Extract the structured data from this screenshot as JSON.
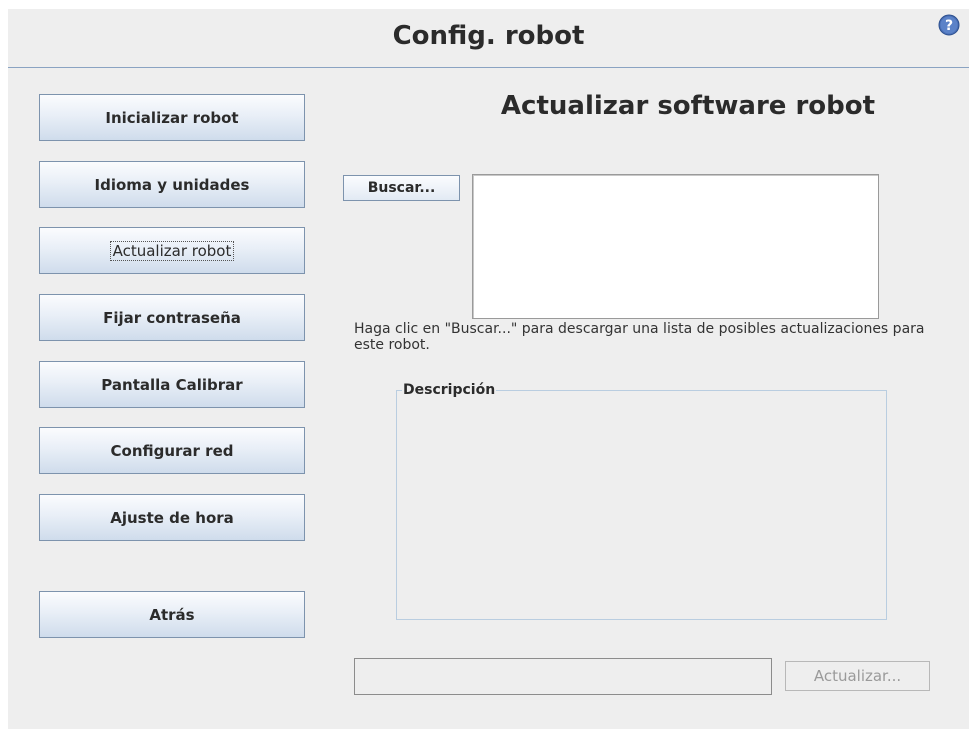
{
  "header": {
    "title": "Config. robot"
  },
  "sidebar": {
    "items": [
      {
        "label": "Inicializar robot"
      },
      {
        "label": "Idioma y unidades"
      },
      {
        "label": "Actualizar robot"
      },
      {
        "label": "Fijar contraseña"
      },
      {
        "label": "Pantalla Calibrar"
      },
      {
        "label": "Configurar red"
      },
      {
        "label": "Ajuste de hora"
      }
    ],
    "back_label": "Atrás"
  },
  "main": {
    "title": "Actualizar software robot",
    "search_button": "Buscar...",
    "hint": "Haga clic en \"Buscar...\" para descargar una lista de posibles actualizaciones para este robot.",
    "description_legend": "Descripción",
    "update_field_value": "",
    "update_button": "Actualizar..."
  },
  "colors": {
    "accent_border": "#7d93ad",
    "help_icon": "#4a6fb5"
  },
  "icons": {
    "help": "help-icon"
  }
}
